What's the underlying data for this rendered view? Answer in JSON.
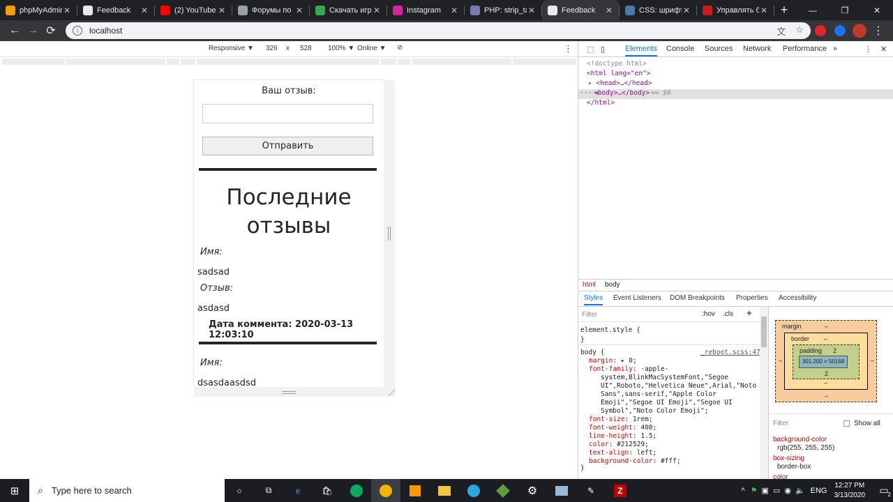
{
  "tabs": [
    {
      "title": "phpMyAdmin",
      "icon": "phpmyadmin-icon",
      "color": "#f89c0e"
    },
    {
      "title": "Feedback",
      "icon": "globe-icon",
      "color": "#e8eaed"
    },
    {
      "title": "(2) YouTube",
      "icon": "youtube-icon",
      "color": "#ff0000"
    },
    {
      "title": "Форумы по",
      "icon": "forum-icon",
      "color": "#9aa0a6"
    },
    {
      "title": "Скачать игр",
      "icon": "green-circle-icon",
      "color": "#34a853"
    },
    {
      "title": "Instagram",
      "icon": "instagram-icon",
      "color": "#d6249f"
    },
    {
      "title": "PHP: strip_ta",
      "icon": "php-icon",
      "color": "#777bb3"
    },
    {
      "title": "Feedback",
      "icon": "globe-icon",
      "color": "#e8eaed",
      "active": true
    },
    {
      "title": "CSS: шрифт",
      "icon": "w3-icon",
      "color": "#4a7aa7"
    },
    {
      "title": "Управлять б",
      "icon": "opera-icon",
      "color": "#cc1b1b"
    }
  ],
  "address": {
    "url": "localhost"
  },
  "device_toolbar": {
    "mode": "Responsive ▼",
    "width": "326",
    "times": "x",
    "height": "528",
    "zoom": "100% ▼",
    "network": "Online ▼"
  },
  "page": {
    "feedback_label": "Ваш отзыв:",
    "submit_label": "Отправить",
    "heading": "Последние отзывы",
    "comments": [
      {
        "name_label": "Имя:",
        "name": "sadsad",
        "review_label": "Отзыв:",
        "review": "asdasd",
        "date": "Дата коммента: 2020-03-13 12:03:10"
      },
      {
        "name_label": "Имя:",
        "name": "dsasdaasdsd"
      }
    ]
  },
  "devtools": {
    "tabs": [
      "Elements",
      "Console",
      "Sources",
      "Network",
      "Performance",
      "»"
    ],
    "dom": {
      "doctype": "<!doctype html>",
      "html_open": "<html lang=\"en\">",
      "head": "<head>…</head>",
      "body": "<body>…</body>",
      "body_suffix": "== $0",
      "html_close": "</html>"
    },
    "breadcrumbs": [
      "html",
      "body"
    ],
    "subtabs": [
      "Styles",
      "Event Listeners",
      "DOM Breakpoints",
      "Properties",
      "Accessibility"
    ],
    "filter_placeholder": "Filter",
    "hov": ":hov",
    "cls": ".cls",
    "add": "+",
    "element_style": "element.style {",
    "close_brace": "}",
    "rule_selector": "body {",
    "rule_source": "_reboot.scss:47",
    "rules": [
      {
        "prop": "margin:",
        "val": "▸ 0;"
      },
      {
        "prop": "font-family:",
        "val": "-apple-"
      },
      {
        "prop": "",
        "val": "system,BlinkMacSystemFont,\"Segoe"
      },
      {
        "prop": "",
        "val": "UI\",Roboto,\"Helvetica Neue\",Arial,\"Noto"
      },
      {
        "prop": "",
        "val": "Sans\",sans-serif,\"Apple Color"
      },
      {
        "prop": "",
        "val": "Emoji\",\"Segoe UI Emoji\",\"Segoe UI"
      },
      {
        "prop": "",
        "val": "Symbol\",\"Noto Color Emoji\";"
      },
      {
        "prop": "font-size:",
        "val": "1rem;"
      },
      {
        "prop": "font-weight:",
        "val": "400;"
      },
      {
        "prop": "line-height:",
        "val": "1.5;"
      },
      {
        "prop": "color:",
        "val": "#212529;"
      },
      {
        "prop": "text-align:",
        "val": "left;"
      },
      {
        "prop": "background-color:",
        "val": "#fff;"
      }
    ],
    "boxmodel": {
      "margin": "margin",
      "border": "border",
      "padding": "padding",
      "padding_val": "2",
      "content": "301.200 × 50168",
      "dash": "–",
      "side": "2"
    },
    "computed_filter": "Filter",
    "show_all": "Show all",
    "computed": [
      {
        "prop": "background-color",
        "val": "rgb(255, 255, 255)"
      },
      {
        "prop": "box-sizing",
        "val": "border-box"
      },
      {
        "prop": "color",
        "val": ""
      }
    ]
  },
  "taskbar": {
    "search_placeholder": "Type here to search",
    "lang": "ENG",
    "time": "12:27 PM",
    "date": "3/13/2020",
    "notif_count": "2"
  }
}
